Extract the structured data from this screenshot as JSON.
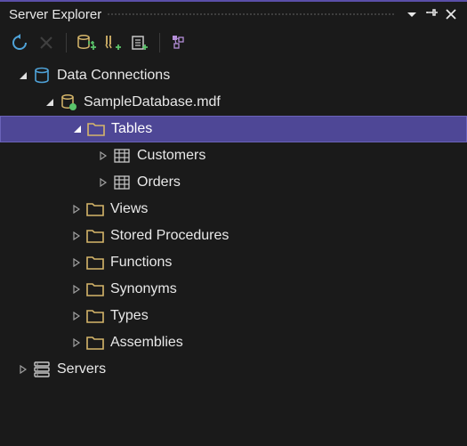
{
  "panel": {
    "title": "Server Explorer"
  },
  "toolbar": {
    "refresh": "Refresh",
    "stop": "Stop",
    "connect_db": "Connect to Database",
    "connect_server": "Connect to Server",
    "azure": "Azure",
    "services": "Services"
  },
  "tree": {
    "data_connections": "Data Connections",
    "sample_db": "SampleDatabase.mdf",
    "tables": "Tables",
    "customers": "Customers",
    "orders": "Orders",
    "views": "Views",
    "stored_procedures": "Stored Procedures",
    "functions": "Functions",
    "synonyms": "Synonyms",
    "types": "Types",
    "assemblies": "Assemblies",
    "servers": "Servers"
  }
}
